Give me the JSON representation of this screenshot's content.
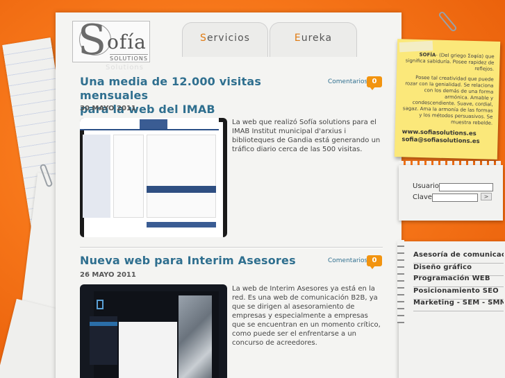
{
  "logo": {
    "initial": "S",
    "name": "ofía",
    "sub": "SOLUTIONS",
    "reflection": "Solutions"
  },
  "tabs": [
    {
      "first": "S",
      "rest": "ervicios"
    },
    {
      "first": "E",
      "rest": "ureka"
    }
  ],
  "posts": [
    {
      "title_line1": "Una media de 12.000 visitas mensuales",
      "title_line2": "para la web del IMAB",
      "date": "30 MAYO 2011",
      "comments_label": "Comentarios",
      "comments_count": "0",
      "body": "La web que realizó Sofía solutions para el IMAB Institut municipal d'arxius i biblioteques de Gandia está generando un tráfico diario cerca de las 500 visitas."
    },
    {
      "title_line1": "Nueva web para Interim Asesores",
      "date": "26 MAYO 2011",
      "comments_label": "Comentarios",
      "comments_count": "0",
      "body": "La web de Interim Asesores ya está en la red. Es una web de comunicación B2B, ya que se dirigen al asesoramiento de empresas y especialmente a empresas que se encuentran en un momento crítico, como puede ser el enfrentarse a un concurso de acreedores."
    }
  ],
  "note": {
    "definition_head": "SOFÍA",
    "definition": "- (Del griego Σοφία) que significa sabiduría. Posee rapidez de reflejos.",
    "para2": "Posee tal creatividad que puede rozar con la genialidad. Se relaciona con los demás de una forma armónica. Amable y condescendiente. Suave, cordial, sagaz. Ama la armonía de las formas y los métodos persuasivos. Se muestra rebelde.",
    "web": "www.sofiasolutions.es",
    "email": "sofia@sofiasolutions.es"
  },
  "login": {
    "user_label": "Usuario:",
    "pass_label": "Clave:",
    "submit": ">"
  },
  "services": [
    "Asesoría de comunicación",
    "Diseño gráfico",
    "Programación WEB",
    "Posicionamiento SEO",
    "Marketing - SEM - SMM"
  ],
  "colors": {
    "background": "#f7771a",
    "title_blue": "#2f6f8f",
    "accent_orange": "#f29410",
    "note_yellow": "#fbe87a"
  }
}
